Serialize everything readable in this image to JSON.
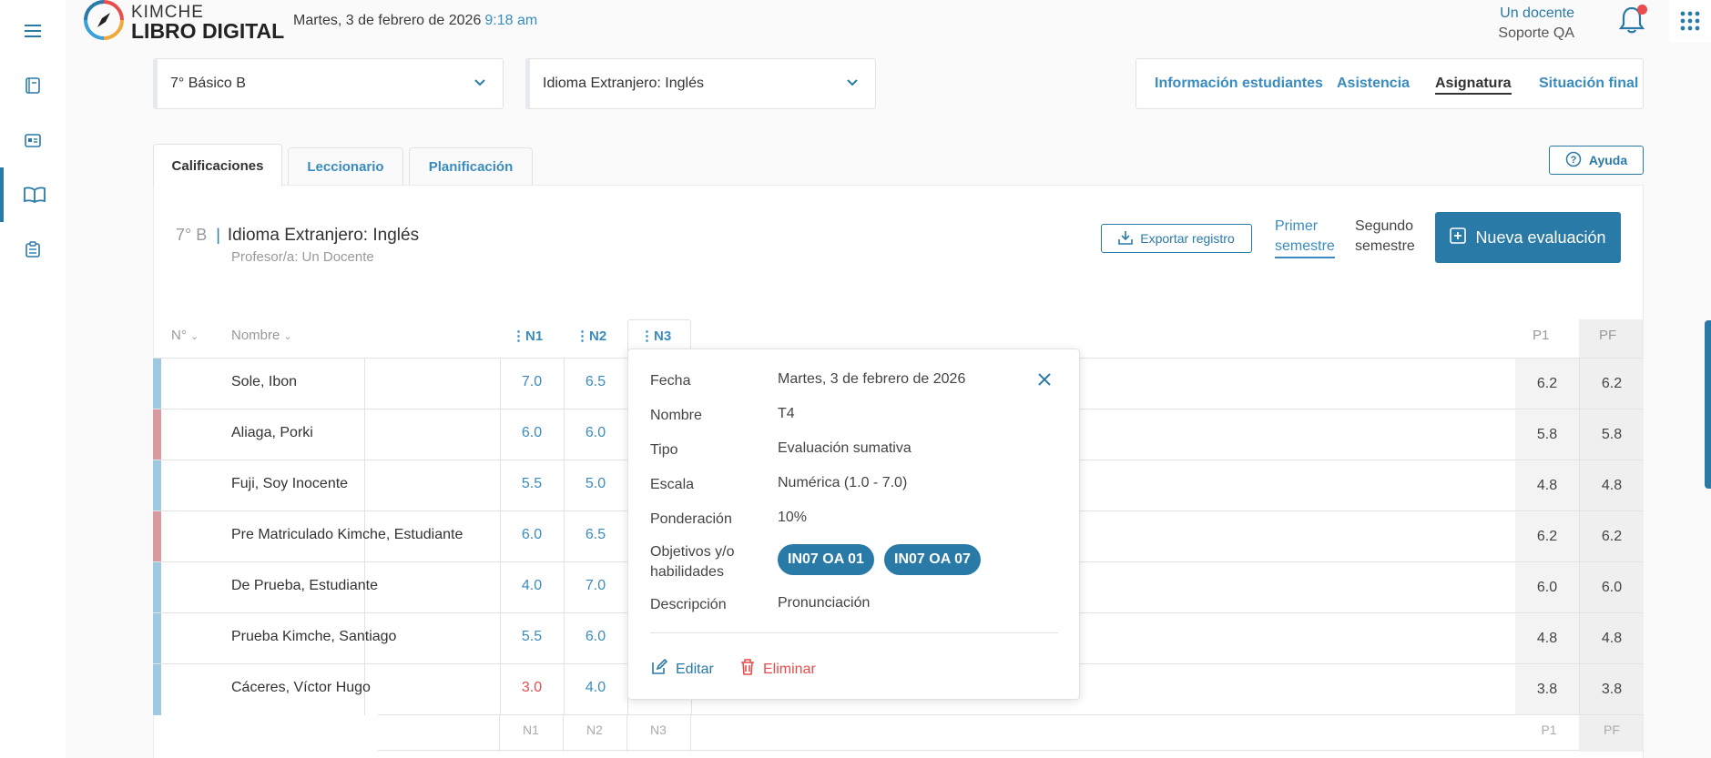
{
  "app": {
    "brand_top": "KIMCHE",
    "brand_bottom": "LIBRO DIGITAL",
    "date": "Martes, 3 de febrero de 2026",
    "time": "9:18 am"
  },
  "sidebar": {
    "items": [
      {
        "icon": "menu-icon"
      },
      {
        "icon": "notebook-icon"
      },
      {
        "icon": "id-card-icon"
      },
      {
        "icon": "open-book-icon",
        "active": true
      },
      {
        "icon": "clipboard-icon"
      }
    ]
  },
  "user": {
    "name": "Un docente",
    "role": "Soporte QA"
  },
  "selects": {
    "course": "7° Básico B",
    "subject": "Idioma Extranjero: Inglés"
  },
  "nav_tabs": [
    {
      "label": "Información estudiantes"
    },
    {
      "label": "Asistencia"
    },
    {
      "label": "Asignatura",
      "active": true
    },
    {
      "label": "Situación final"
    }
  ],
  "content_tabs": [
    {
      "label": "Calificaciones",
      "active": true
    },
    {
      "label": "Leccionario"
    },
    {
      "label": "Planificación"
    }
  ],
  "help_label": "Ayuda",
  "header": {
    "course_short": "7° B",
    "subject": "Idioma Extranjero: Inglés",
    "teacher": "Profesor/a: Un Docente",
    "export_label": "Exportar registro",
    "semester_1": [
      "Primer",
      "semestre"
    ],
    "semester_2": [
      "Segundo",
      "semestre"
    ],
    "new_eval_label": "Nueva evaluación"
  },
  "table": {
    "headers": {
      "num": "N°",
      "name": "Nombre",
      "n1": "N1",
      "n2": "N2",
      "n3": "N3",
      "p1": "P1",
      "pf": "PF"
    },
    "rows": [
      {
        "name": "Sole, Ibon",
        "n1": "7.0",
        "n2": "6.5",
        "p1": "6.2",
        "pf": "6.2",
        "stripe": "#9ecae1"
      },
      {
        "name": "Aliaga, Porki",
        "n1": "6.0",
        "n2": "6.0",
        "p1": "5.8",
        "pf": "5.8",
        "stripe": "#d89a9e"
      },
      {
        "name": "Fuji, Soy Inocente",
        "n1": "5.5",
        "n2": "5.0",
        "p1": "4.8",
        "pf": "4.8",
        "stripe": "#9ecae1"
      },
      {
        "name": "Pre Matriculado Kimche, Estudiante",
        "n1": "6.0",
        "n2": "6.5",
        "p1": "6.2",
        "pf": "6.2",
        "stripe": "#d89a9e"
      },
      {
        "name": "De Prueba, Estudiante",
        "n1": "4.0",
        "n2": "7.0",
        "p1": "6.0",
        "pf": "6.0",
        "stripe": "#9ecae1"
      },
      {
        "name": "Prueba Kimche, Santiago",
        "n1": "5.5",
        "n2": "6.0",
        "p1": "4.8",
        "pf": "4.8",
        "stripe": "#9ecae1"
      },
      {
        "name": "Cáceres, Víctor Hugo",
        "n1": "3.0",
        "n2": "4.0",
        "p1": "3.8",
        "pf": "3.8",
        "stripe": "#9ecae1",
        "n1_failing": true
      }
    ],
    "footer": {
      "n1": "N1",
      "n2": "N2",
      "n3": "N3",
      "p1": "P1",
      "pf": "PF"
    }
  },
  "popup": {
    "labels": {
      "date": "Fecha",
      "name": "Nombre",
      "type": "Tipo",
      "scale": "Escala",
      "weight": "Ponderación",
      "objectives_1": "Objetivos y/o",
      "objectives_2": "habilidades",
      "description": "Descripción"
    },
    "values": {
      "date": "Martes, 3 de febrero de 2026",
      "name": "T4",
      "type": "Evaluación sumativa",
      "scale": "Numérica (1.0 - 7.0)",
      "weight": "10%",
      "objectives": [
        "IN07 OA 01",
        "IN07 OA 07"
      ],
      "description": "Pronunciación"
    },
    "edit_label": "Editar",
    "delete_label": "Eliminar"
  },
  "colors": {
    "accent": "#2a7aa8",
    "link": "#3a8cc0",
    "danger": "#e84c4c"
  }
}
